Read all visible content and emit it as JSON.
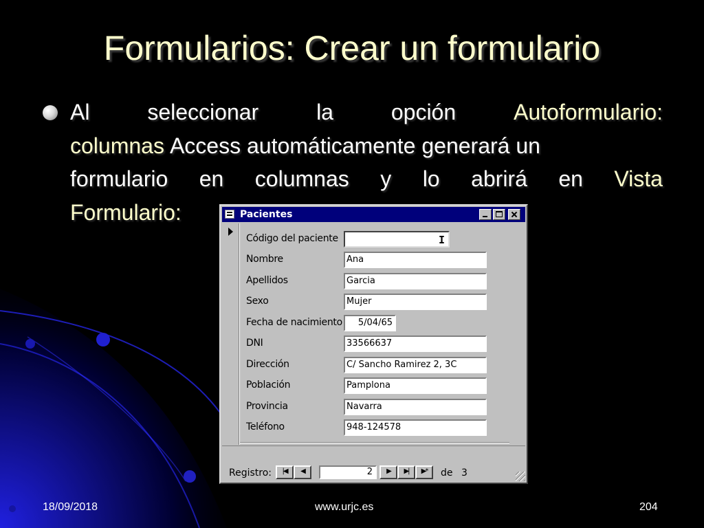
{
  "slide": {
    "title": "Formularios: Crear un formulario",
    "bullet": {
      "line1_words": [
        "Al",
        "seleccionar",
        "la",
        "opción"
      ],
      "line1_end": "Autoformulario:",
      "line2_start": "columnas",
      "line2_rest": "Access automáticamente generará un",
      "line3_words": [
        "formulario",
        "en",
        "columnas",
        "y",
        "lo",
        "abrirá",
        "en"
      ],
      "line3_end": "Vista",
      "line4": "Formulario:"
    }
  },
  "window": {
    "title": "Pacientes",
    "fields": [
      {
        "label": "Código del paciente",
        "value": ""
      },
      {
        "label": "Nombre",
        "value": "Ana"
      },
      {
        "label": "Apellidos",
        "value": "Garcia"
      },
      {
        "label": "Sexo",
        "value": "Mujer"
      },
      {
        "label": "Fecha de nacimiento",
        "value": "5/04/65"
      },
      {
        "label": "DNI",
        "value": "33566637"
      },
      {
        "label": "Dirección",
        "value": "C/ Sancho Ramirez 2, 3C"
      },
      {
        "label": "Población",
        "value": "Pamplona"
      },
      {
        "label": "Provincia",
        "value": "Navarra"
      },
      {
        "label": "Teléfono",
        "value": "948-124578"
      }
    ],
    "navigation": {
      "label": "Registro:",
      "current": "2",
      "of_label": "de",
      "total": "3",
      "first_glyph": "|◀",
      "prev_glyph": "◀",
      "next_glyph": "▶",
      "last_glyph": "▶|",
      "new_glyph": "▶*"
    }
  },
  "footer": {
    "date": "18/09/2018",
    "url": "www.urjc.es",
    "page": "204"
  },
  "colors": {
    "background": "#000000",
    "title_text": "#ffffcc",
    "body_text": "#ffffff",
    "highlight_text": "#ffffcc",
    "titlebar": "#00007b",
    "window_face": "#c0c0c0",
    "decoration": "#1a1ad6"
  }
}
